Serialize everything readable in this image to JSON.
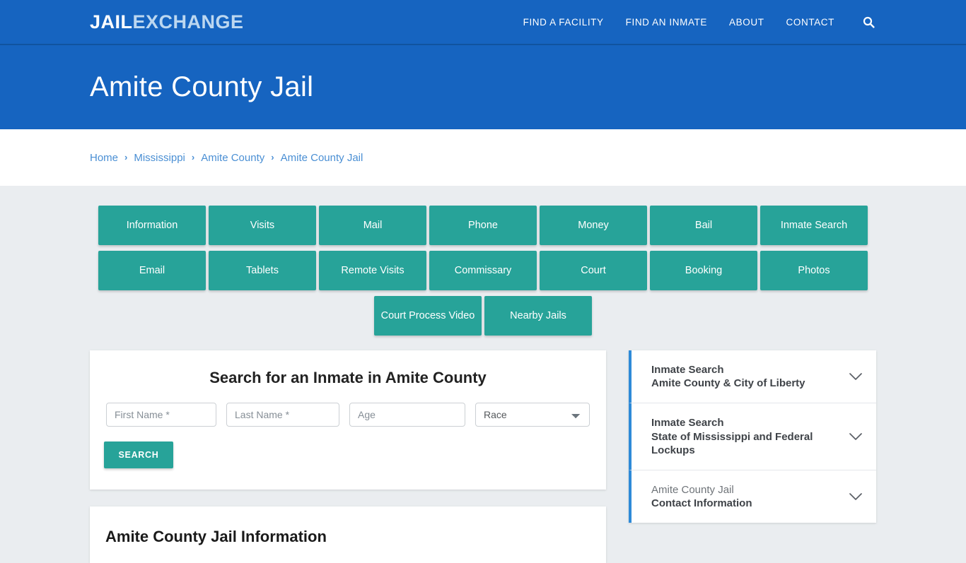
{
  "header": {
    "logo_primary": "JAIL",
    "logo_secondary": "EXCHANGE",
    "nav": [
      {
        "label": "FIND A FACILITY"
      },
      {
        "label": "FIND AN INMATE"
      },
      {
        "label": "ABOUT"
      },
      {
        "label": "CONTACT"
      }
    ],
    "search_icon": "search-icon",
    "bg_color": "#1664c0"
  },
  "hero": {
    "title": "Amite County Jail"
  },
  "breadcrumb": {
    "separator": "›",
    "items": [
      {
        "label": "Home"
      },
      {
        "label": "Mississippi"
      },
      {
        "label": "Amite County"
      },
      {
        "label": "Amite County Jail"
      }
    ],
    "link_color": "#4a8fd4"
  },
  "nav_buttons": {
    "accent_color": "#27a399",
    "rows": [
      [
        {
          "label": "Information"
        },
        {
          "label": "Visits"
        },
        {
          "label": "Mail"
        },
        {
          "label": "Phone"
        },
        {
          "label": "Money"
        },
        {
          "label": "Bail"
        },
        {
          "label": "Inmate Search"
        }
      ],
      [
        {
          "label": "Email"
        },
        {
          "label": "Tablets"
        },
        {
          "label": "Remote Visits"
        },
        {
          "label": "Commissary"
        },
        {
          "label": "Court"
        },
        {
          "label": "Booking"
        },
        {
          "label": "Photos"
        }
      ],
      [
        {
          "label": "Court Process Video"
        },
        {
          "label": "Nearby Jails"
        }
      ]
    ]
  },
  "search_panel": {
    "title": "Search for an Inmate in Amite County",
    "first_name_placeholder": "First Name *",
    "last_name_placeholder": "Last Name *",
    "age_placeholder": "Age",
    "race_selected": "Race",
    "race_options": [
      "Race"
    ],
    "submit_label": "SEARCH"
  },
  "info_panel": {
    "title": "Amite County Jail Information"
  },
  "sidebar": {
    "accent_color": "#2e8ad8",
    "items": [
      {
        "line1": "Inmate Search",
        "line2": "Amite County & City of Liberty",
        "muted": false,
        "icon": "chevron-down-icon"
      },
      {
        "line1": "Inmate Search",
        "line2": "State of Mississippi and Federal Lockups",
        "muted": false,
        "icon": "chevron-down-icon"
      },
      {
        "line1": "Amite County Jail",
        "line2": "Contact Information",
        "muted": true,
        "icon": "chevron-down-icon"
      }
    ]
  }
}
